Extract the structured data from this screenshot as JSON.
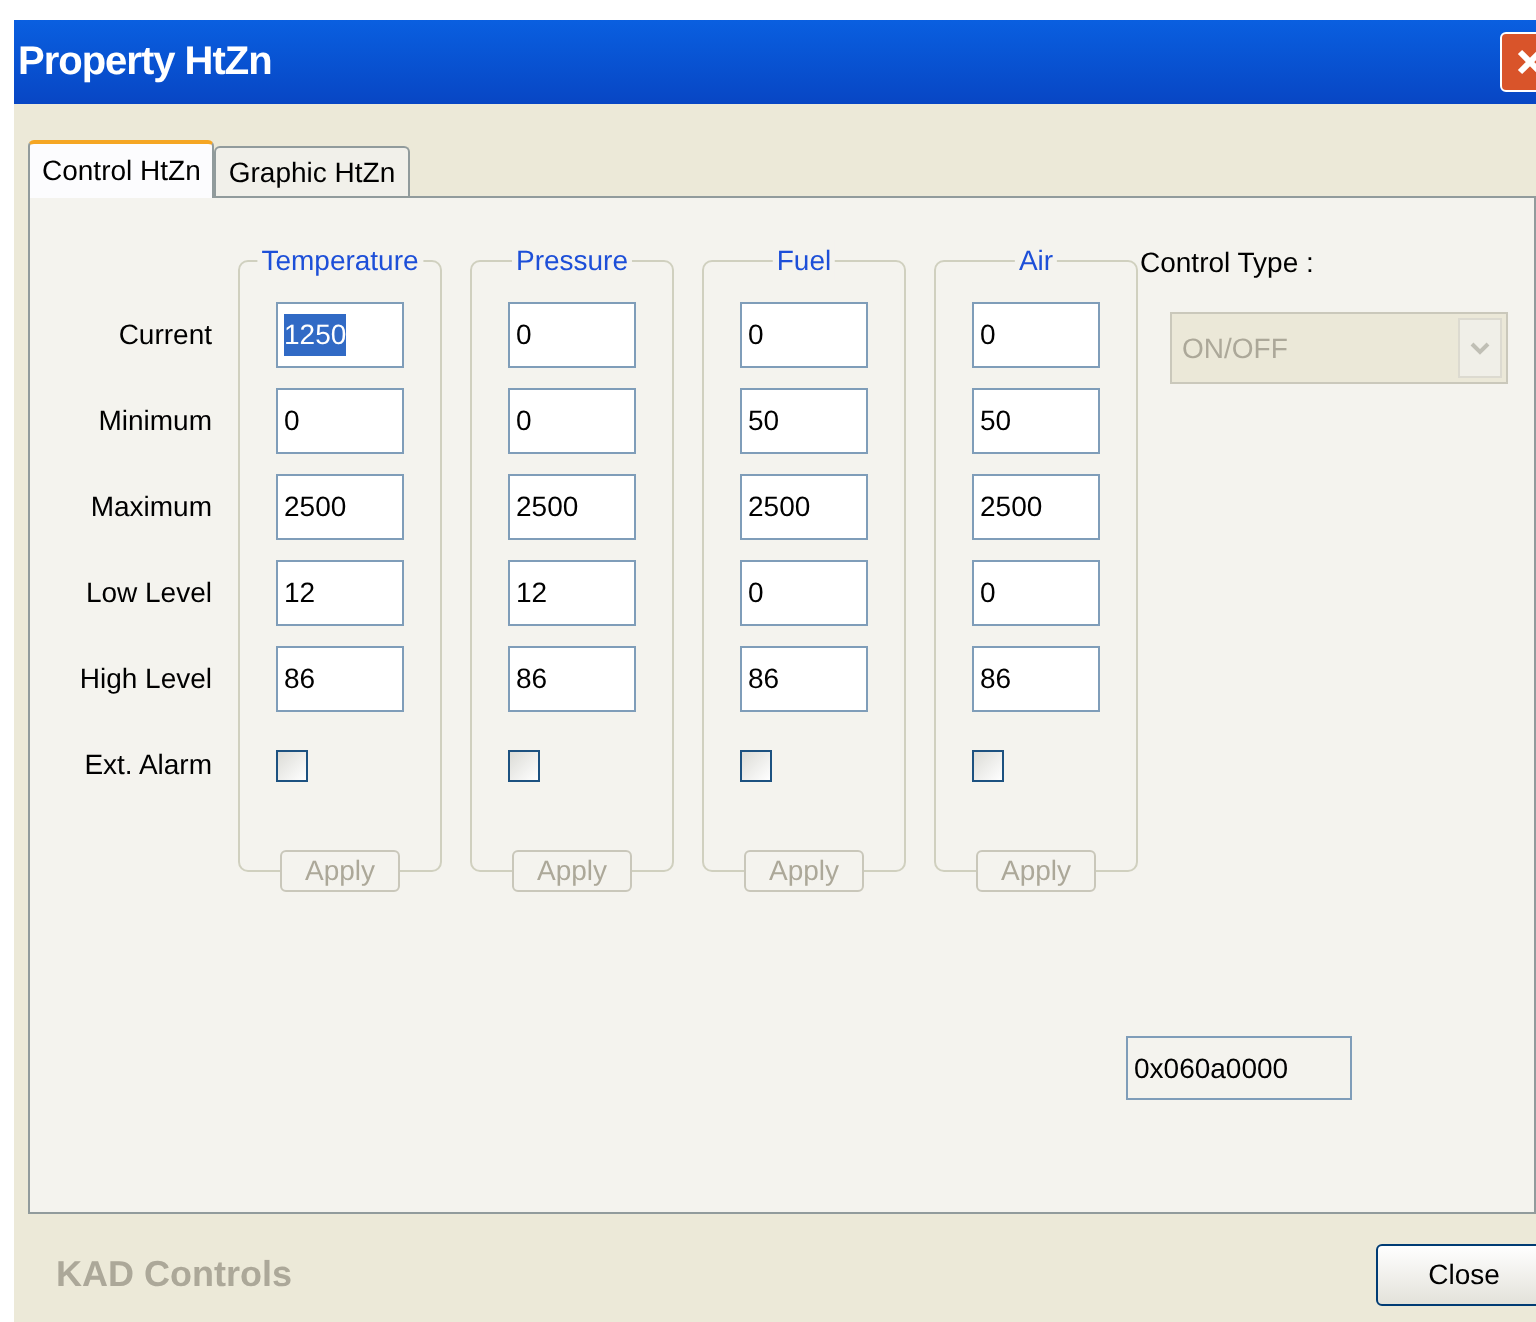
{
  "window": {
    "title": "Property HtZn"
  },
  "tabs": [
    {
      "label": "Control HtZn",
      "selected": true
    },
    {
      "label": "Graphic HtZn",
      "selected": false
    }
  ],
  "row_labels": [
    "Current",
    "Minimum",
    "Maximum",
    "Low Level",
    "High Level",
    "Ext. Alarm"
  ],
  "groups": [
    {
      "title": "Temperature",
      "values": [
        {
          "text": "1250",
          "selected": true
        },
        {
          "text": "0",
          "selected": false
        },
        {
          "text": "2500",
          "selected": false
        },
        {
          "text": "12",
          "selected": false
        },
        {
          "text": "86",
          "selected": false
        }
      ],
      "ext_alarm": {
        "checked": false
      },
      "apply": {
        "label": "Apply",
        "disabled": true
      }
    },
    {
      "title": "Pressure",
      "values": [
        {
          "text": "0",
          "selected": false
        },
        {
          "text": "0",
          "selected": false
        },
        {
          "text": "2500",
          "selected": false
        },
        {
          "text": "12",
          "selected": false
        },
        {
          "text": "86",
          "selected": false
        }
      ],
      "ext_alarm": {
        "checked": false
      },
      "apply": {
        "label": "Apply",
        "disabled": true
      }
    },
    {
      "title": "Fuel",
      "values": [
        {
          "text": "0",
          "selected": false
        },
        {
          "text": "50",
          "selected": false
        },
        {
          "text": "2500",
          "selected": false
        },
        {
          "text": "0",
          "selected": false
        },
        {
          "text": "86",
          "selected": false
        }
      ],
      "ext_alarm": {
        "checked": false
      },
      "apply": {
        "label": "Apply",
        "disabled": true
      }
    },
    {
      "title": "Air",
      "values": [
        {
          "text": "0",
          "selected": false
        },
        {
          "text": "50",
          "selected": false
        },
        {
          "text": "2500",
          "selected": false
        },
        {
          "text": "0",
          "selected": false
        },
        {
          "text": "86",
          "selected": false
        }
      ],
      "ext_alarm": {
        "checked": false
      },
      "apply": {
        "label": "Apply",
        "disabled": true
      }
    }
  ],
  "control_type": {
    "label": "Control Type :",
    "value": "ON/OFF",
    "disabled": true
  },
  "address_field": {
    "value": "0x060a0000"
  },
  "footer": {
    "brand": "KAD Controls",
    "close_button": "Close"
  }
}
